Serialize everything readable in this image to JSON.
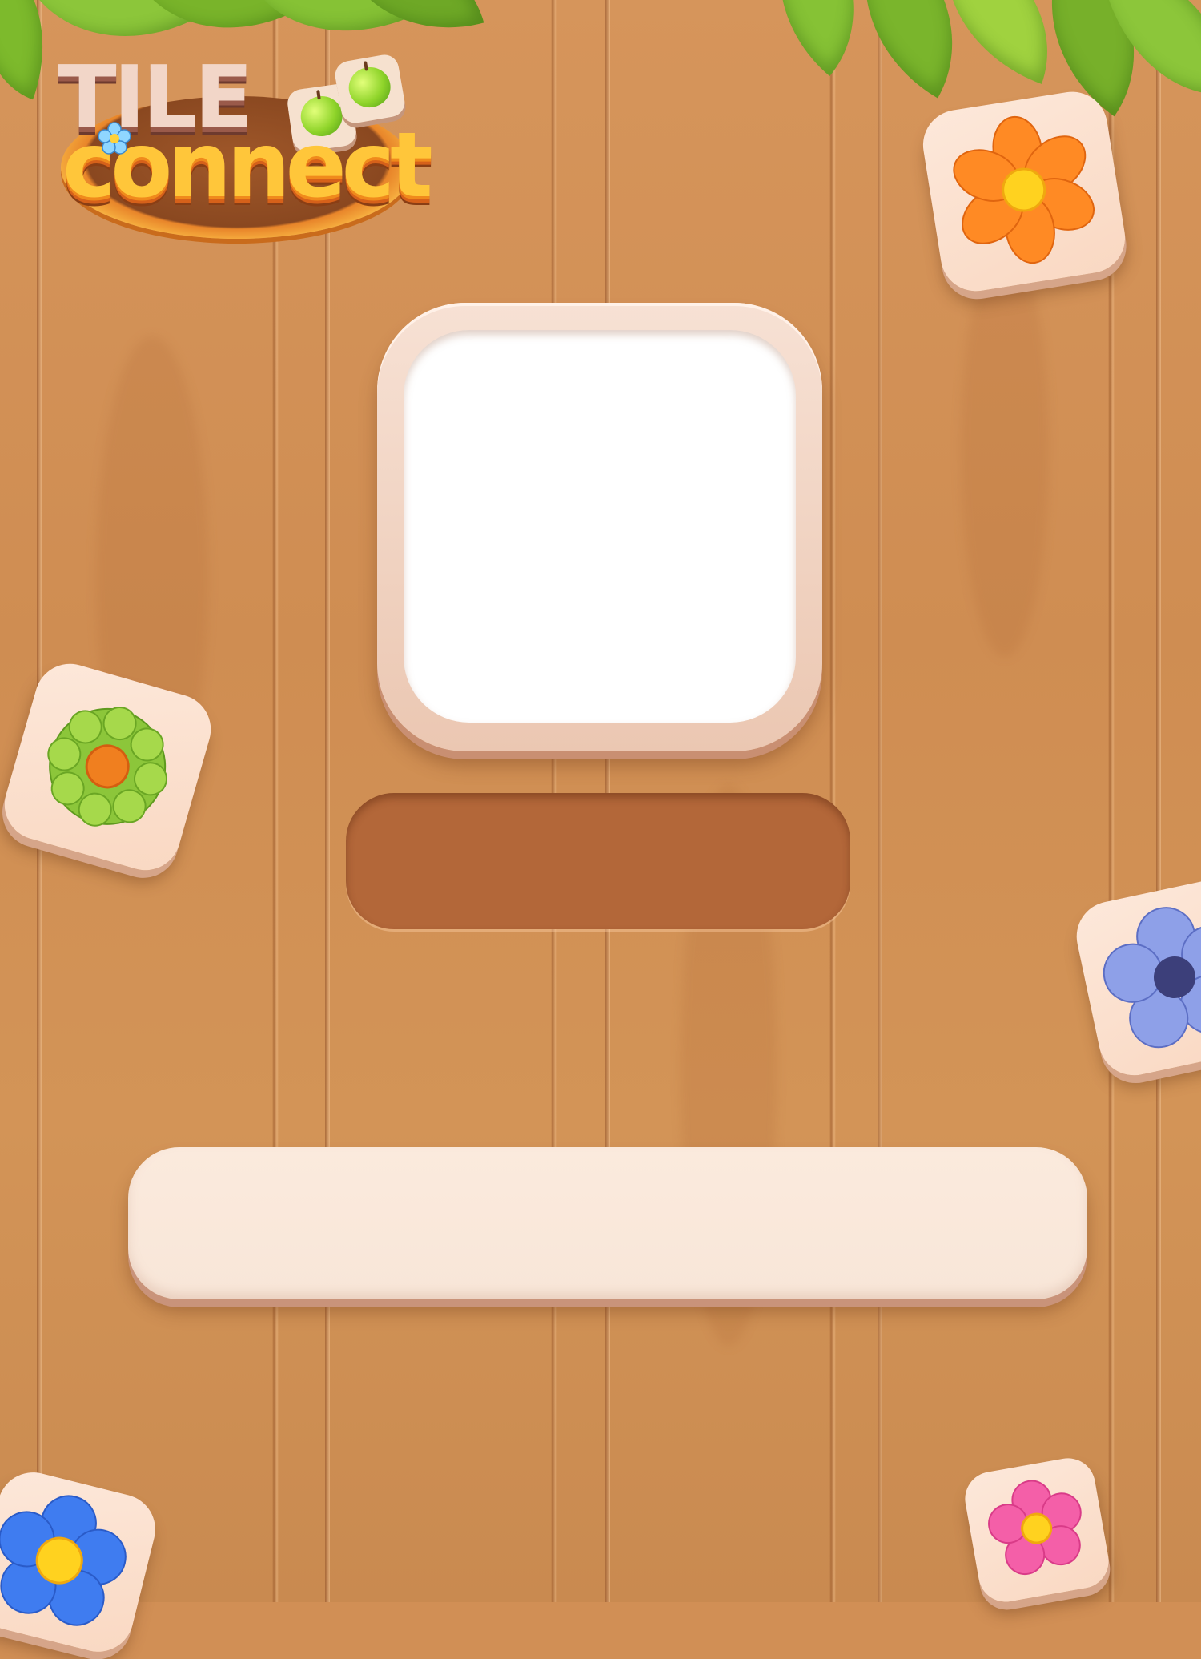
{
  "game": {
    "logo_line1": "TILE",
    "logo_line2": "connect"
  },
  "board": {
    "preview_frame": "",
    "status_slot": "",
    "action_bar": ""
  },
  "decorations": {
    "tiles": [
      "orange-flower-icon",
      "green-flower-icon",
      "blue-anemone-icon",
      "blue-flower-icon",
      "pink-flower-icon"
    ],
    "top_foliage": [
      "leaves-left-icon",
      "leaves-right-icon"
    ]
  },
  "colors": {
    "wood": "#d18f55",
    "tile_face": "#fde8da",
    "slot": "#b36739",
    "logo_yellow": "#ffc63a"
  }
}
